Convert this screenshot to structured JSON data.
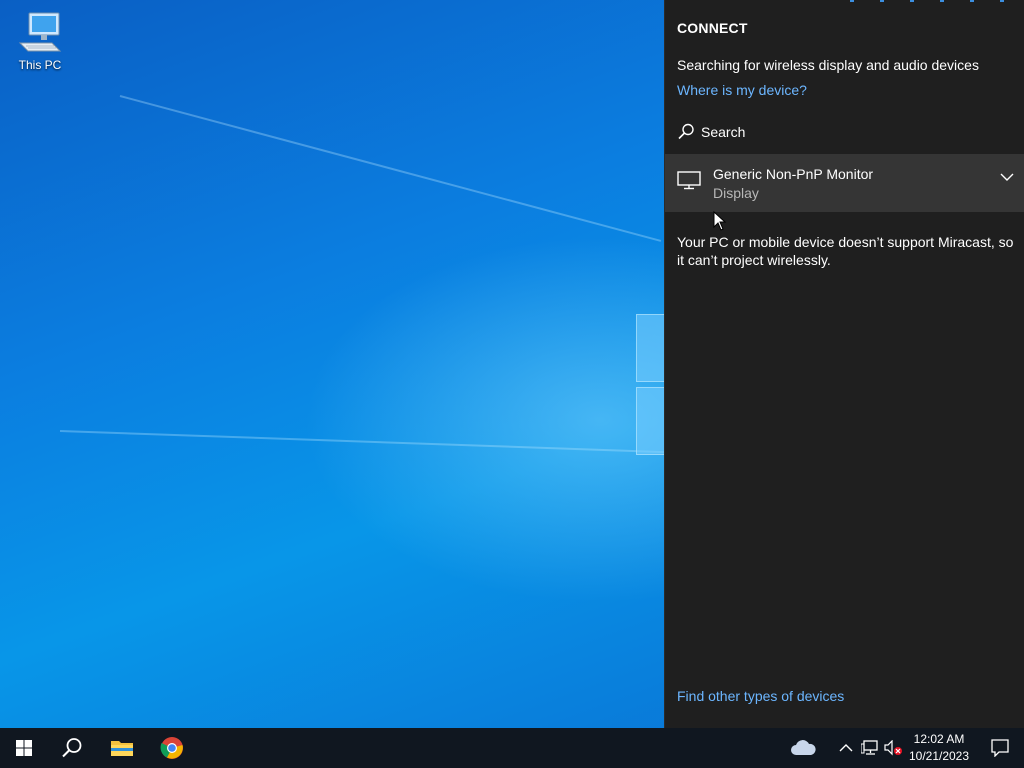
{
  "desktop": {
    "icons": [
      {
        "label": "This PC",
        "icon": "computer-icon"
      }
    ]
  },
  "connect": {
    "title": "CONNECT",
    "searching_text": "Searching for wireless display and audio devices",
    "where_link": "Where is my device?",
    "search_label": "Search",
    "device": {
      "name": "Generic Non-PnP Monitor",
      "type": "Display",
      "icon": "monitor-icon"
    },
    "miracast_message": "Your PC or mobile device doesn’t support Miracast, so it can’t project wirelessly.",
    "find_other_link": "Find other types of devices"
  },
  "taskbar": {
    "pinned": [
      {
        "name": "start-button",
        "icon": "windows-logo-icon"
      },
      {
        "name": "search-button",
        "icon": "search-icon"
      },
      {
        "name": "file-explorer-button",
        "icon": "folder-icon"
      },
      {
        "name": "chrome-button",
        "icon": "chrome-icon"
      }
    ],
    "tray": {
      "icons": [
        "onedrive-cloud-icon",
        "chevron-up-icon",
        "network-icon",
        "volume-muted-icon"
      ],
      "time": "12:02 AM",
      "date": "10/21/2023"
    }
  },
  "colors": {
    "panel_bg": "#1f1f1f",
    "device_row_bg": "#353535",
    "link": "#6cb6ff",
    "taskbar_bg": "#101720",
    "accent_blue": "#0a7fe0"
  }
}
